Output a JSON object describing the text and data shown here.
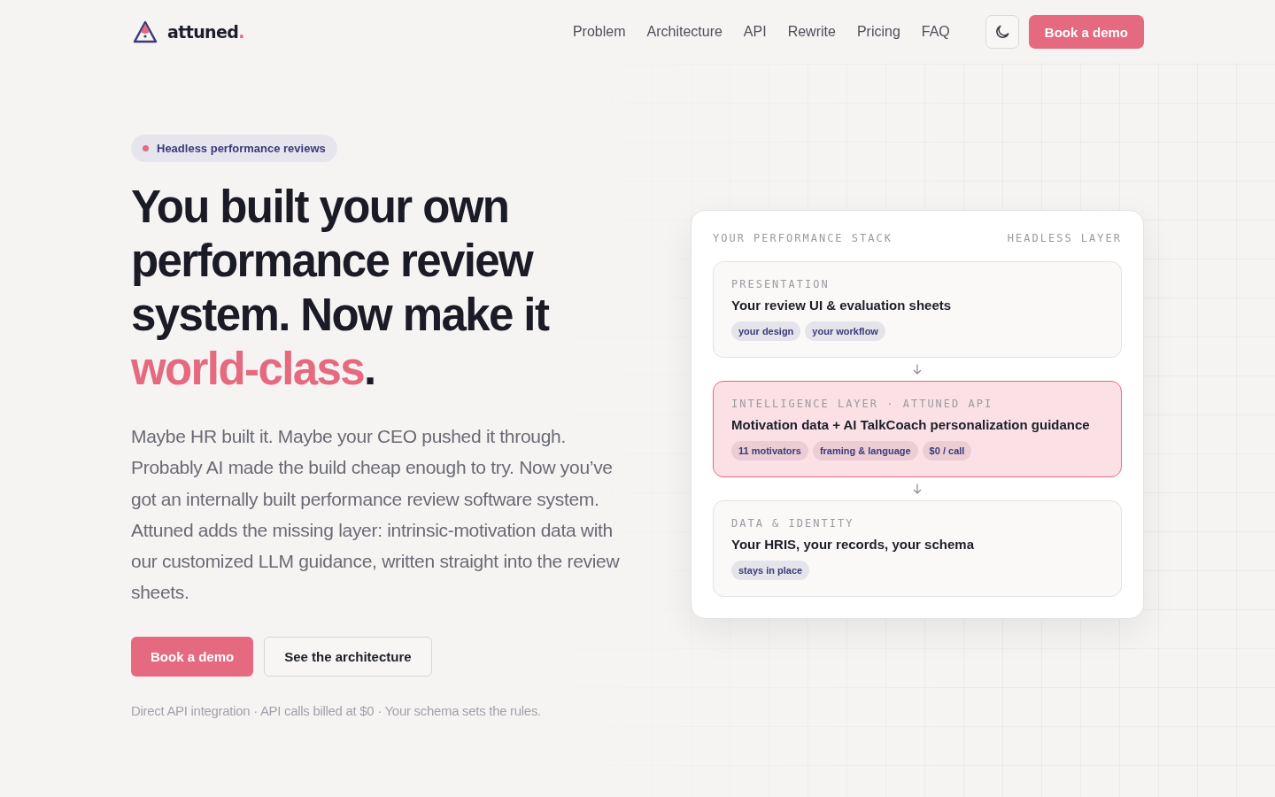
{
  "brand": {
    "name": "attuned",
    "dot": "."
  },
  "nav": [
    {
      "label": "Problem"
    },
    {
      "label": "Architecture"
    },
    {
      "label": "API"
    },
    {
      "label": "Rewrite"
    },
    {
      "label": "Pricing"
    },
    {
      "label": "FAQ"
    }
  ],
  "header_cta": "Book a demo",
  "badge": {
    "label": "Headless performance reviews",
    "color": "#e5697f"
  },
  "headline": {
    "before": "You built your own performance review system. Now make it ",
    "accent": "world-class",
    "after": "."
  },
  "intro": "Maybe HR built it. Maybe your CEO pushed it through. Probably AI made the build cheap enough to try. Now you’ve got an internally built performance review software system. Attuned adds the missing layer: intrinsic-motivation data with our customized LLM guidance, written straight into the review sheets.",
  "buttons": [
    {
      "label": "Book a demo",
      "kind": "primary"
    },
    {
      "label": "See the architecture",
      "kind": "secondary"
    }
  ],
  "footnote": "Direct API integration · API calls billed at $0 · Your schema sets the rules.",
  "stack": {
    "title": "YOUR PERFORMANCE STACK",
    "tag": "HEADLESS LAYER",
    "layers": [
      {
        "eyebrow": "PRESENTATION",
        "title": "Your review UI & evaluation sheets",
        "chips": [
          "your design",
          "your workflow"
        ],
        "highlighted": false
      },
      {
        "eyebrow": "INTELLIGENCE LAYER · ATTUNED API",
        "title": "Motivation data + AI TalkCoach personalization guidance",
        "chips": [
          "11 motivators",
          "framing & language",
          "$0 / call"
        ],
        "highlighted": true
      },
      {
        "eyebrow": "DATA & IDENTITY",
        "title": "Your HRIS, your records, your schema",
        "chips": [
          "stays in place"
        ],
        "highlighted": false
      }
    ]
  }
}
